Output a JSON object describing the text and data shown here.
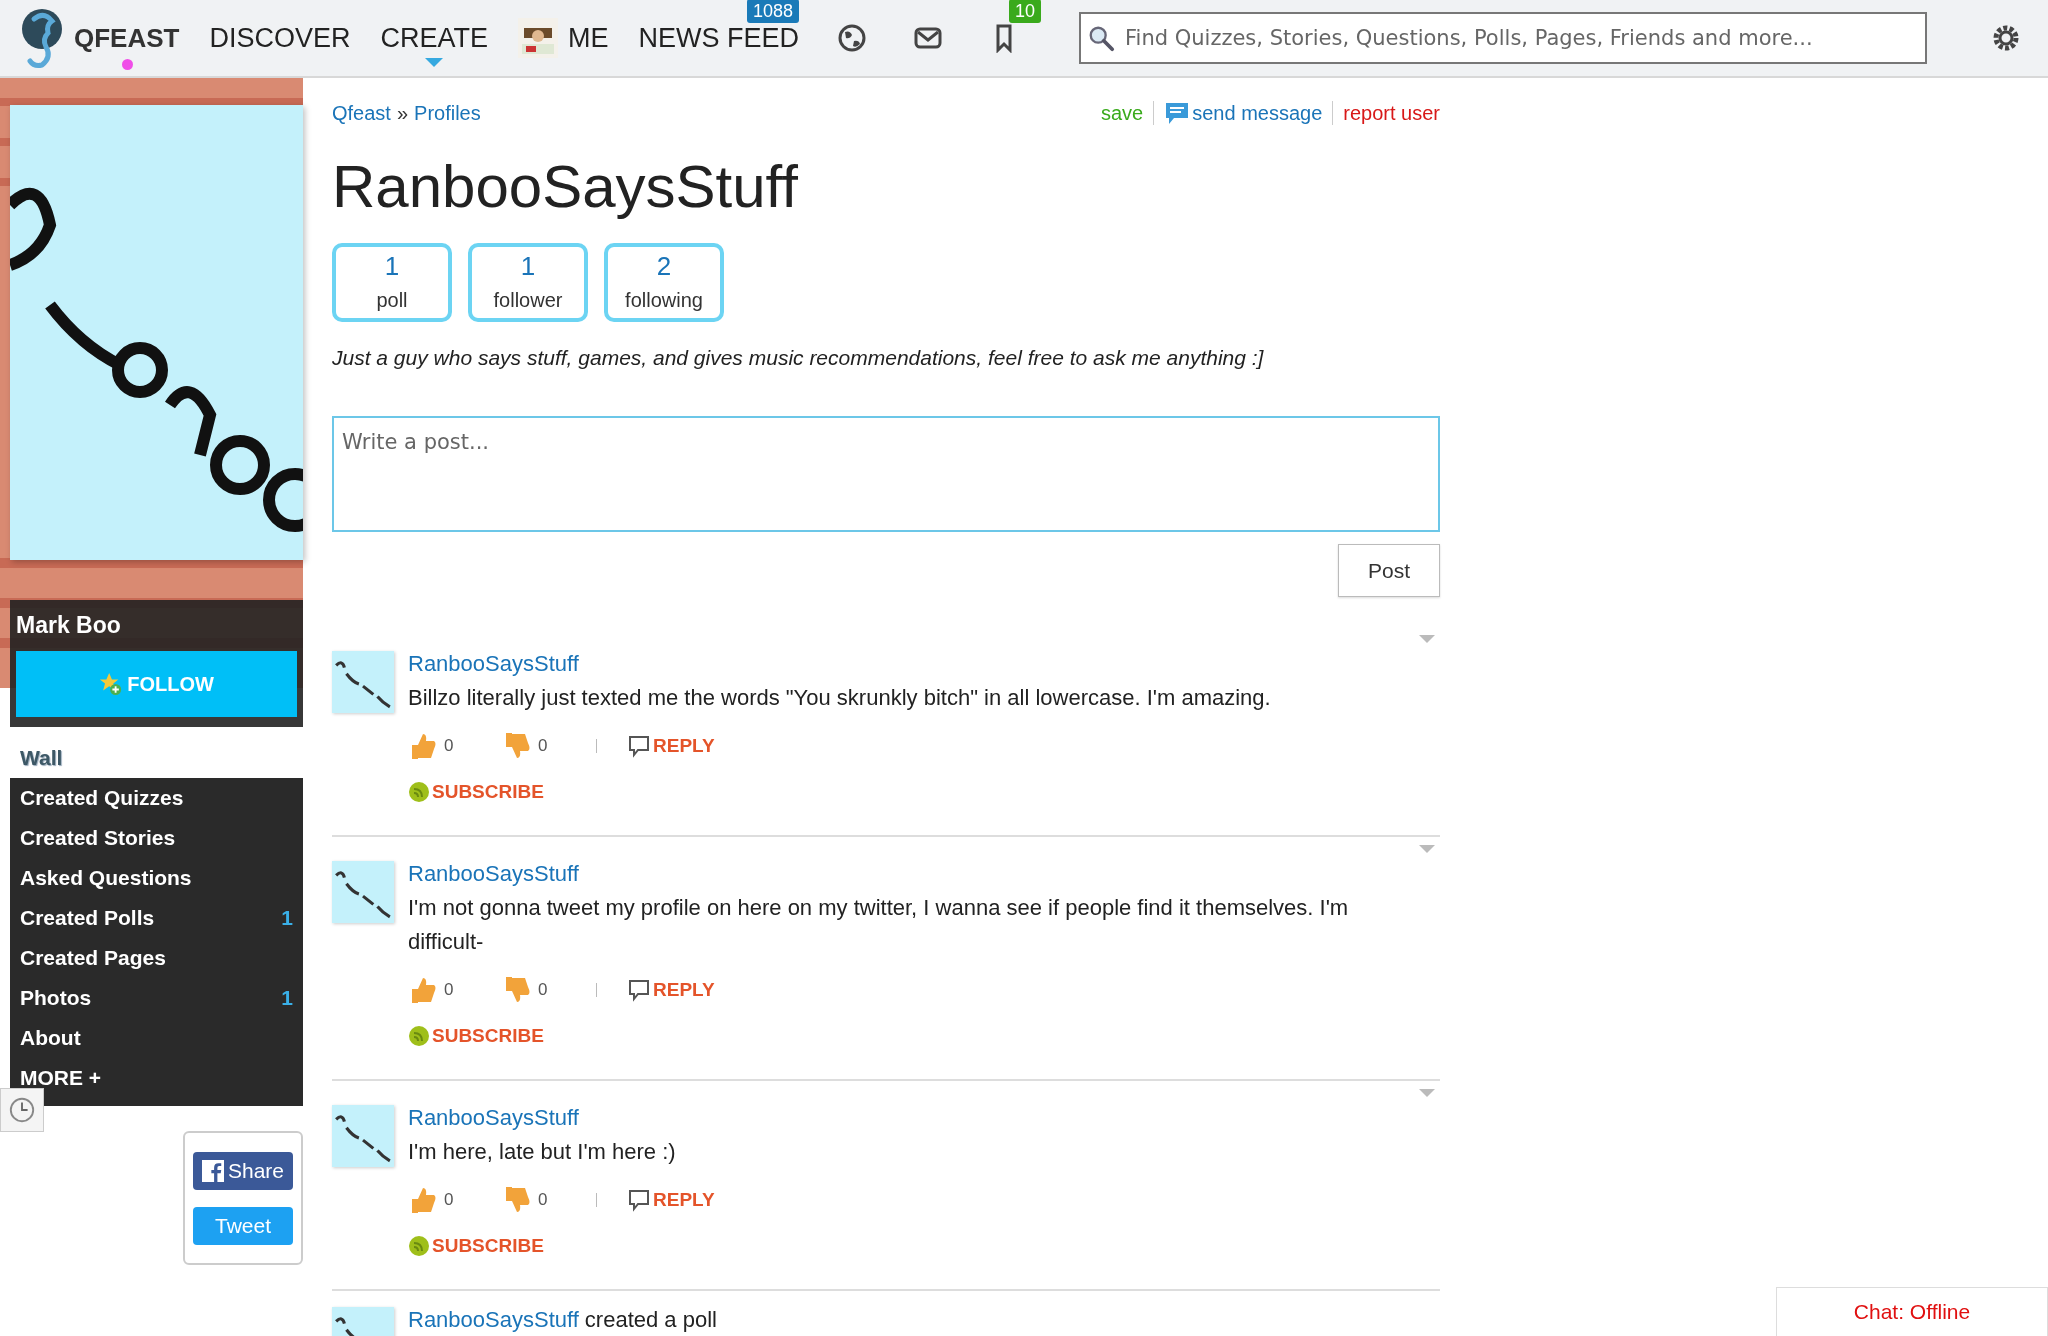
{
  "topbar": {
    "logo": "QFEAST",
    "logo_dot": true,
    "nav": [
      {
        "label": "DISCOVER",
        "kind": "text",
        "selected": false
      },
      {
        "label": "CREATE",
        "kind": "text",
        "selected": true
      },
      {
        "label": "ME",
        "kind": "avatar",
        "selected": false
      },
      {
        "label": "NEWS FEED",
        "kind": "text",
        "selected": false,
        "badge": "1088",
        "color": "#1a7ab8"
      }
    ],
    "icons": [
      {
        "kind": "globe"
      },
      {
        "kind": "mail"
      },
      {
        "kind": "bookmark",
        "badge": "10",
        "color": "#3aaa1c"
      }
    ],
    "search": {
      "placeholder": "Find Quizzes, Stories, Questions, Polls, Pages, Friends and more..."
    }
  },
  "sidebar": {
    "name": "Mark Boo",
    "follow": "FOLLOW",
    "menu": [
      {
        "label": "Wall",
        "selected": true
      },
      {
        "label": "Created Quizzes",
        "selected": false
      },
      {
        "label": "Created Stories",
        "selected": false
      },
      {
        "label": "Asked Questions",
        "selected": false
      },
      {
        "label": "Created Polls",
        "selected": false,
        "count": "1"
      },
      {
        "label": "Created Pages",
        "selected": false
      },
      {
        "label": "Photos",
        "selected": false,
        "count": "1"
      },
      {
        "label": "About",
        "selected": false
      },
      {
        "label": "MORE +",
        "selected": false
      }
    ],
    "share": [
      "Share",
      "Tweet"
    ]
  },
  "breadcrumb": {
    "items": [
      "Qfeast",
      "Profiles"
    ],
    "separator": "»"
  },
  "actions": [
    {
      "label": "save",
      "kind": "save"
    },
    {
      "label": "send message",
      "kind": "message"
    },
    {
      "label": "report user",
      "kind": "report"
    }
  ],
  "title": "RanbooSaysStuff",
  "stats": [
    {
      "value": "1",
      "label": "poll"
    },
    {
      "value": "1",
      "label": "follower"
    },
    {
      "value": "2",
      "label": "following"
    }
  ],
  "bio": "Just a guy who says stuff, games, and gives music recommendations, feel free to ask me anything :]",
  "composer": {
    "placeholder": "Write a post...",
    "button": "Post"
  },
  "posts": [
    {
      "author": "RanbooSaysStuff",
      "text": "Billzo literally just texted me the words \"You skrunkly bitch\" in all lowercase. I'm amazing.",
      "likes": "0",
      "dislikes": "0",
      "reply": "REPLY",
      "subscribe": "SUBSCRIBE"
    },
    {
      "author": "RanbooSaysStuff",
      "text": "I'm not gonna tweet my profile on here on my twitter, I wanna see if people find it themselves. I'm difficult-",
      "likes": "0",
      "dislikes": "0",
      "reply": "REPLY",
      "subscribe": "SUBSCRIBE"
    },
    {
      "author": "RanbooSaysStuff",
      "text": "I'm here, late but I'm here :)",
      "likes": "0",
      "dislikes": "0",
      "reply": "REPLY",
      "subscribe": "SUBSCRIBE"
    },
    {
      "author": "RanbooSaysStuff",
      "action": "created a poll"
    }
  ],
  "chat": "Chat: Offline"
}
